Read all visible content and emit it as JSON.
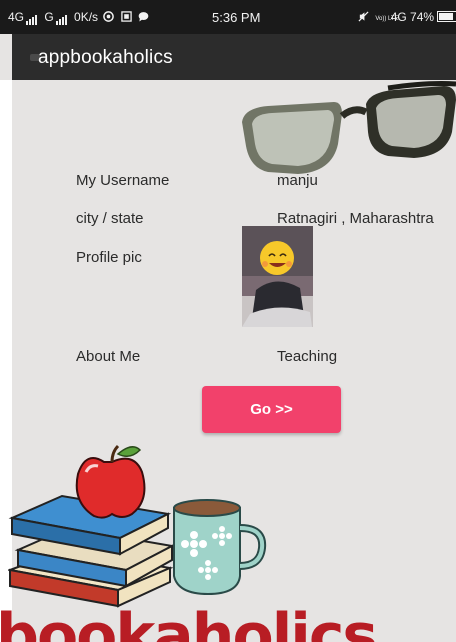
{
  "status_bar": {
    "network_left": "4G",
    "network_mid": "G",
    "data_speed": "0K/s",
    "time": "5:36 PM",
    "volte": "Vo)) LTE",
    "network_right": "4G",
    "battery": "74%",
    "icons": [
      "signal-icon",
      "chrome-icon",
      "gallery-icon",
      "message-icon",
      "mute-icon",
      "battery-icon"
    ]
  },
  "app_bar": {
    "title": "appbookaholics"
  },
  "profile": {
    "username_label": "My Username",
    "username_value": "manju",
    "location_label": "city / state",
    "location_value": "Ratnagiri  , Maharashtra",
    "pic_label": "Profile pic",
    "about_label": "About Me",
    "about_value": "Teaching"
  },
  "actions": {
    "go_label": "Go >>"
  },
  "logo": {
    "text": "bookaholics"
  },
  "colors": {
    "accent": "#f2416b",
    "appbar": "#2c2c2c",
    "background": "#e6e4e3",
    "logo": "#b81d24"
  }
}
